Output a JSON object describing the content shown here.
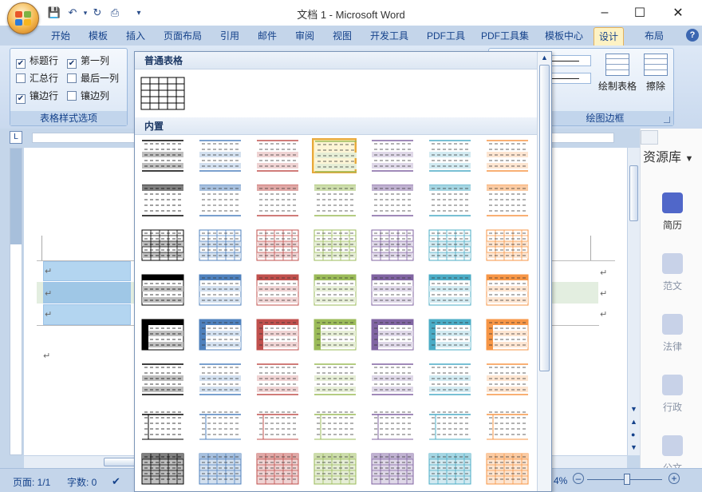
{
  "window": {
    "title": "文档 1 - Microsoft Word",
    "controls": {
      "minimize": "–",
      "maximize": "☐",
      "close": "✕"
    }
  },
  "quick_access": {
    "save_icon": "save-icon",
    "undo_icon": "undo-icon",
    "redo_icon": "redo-icon",
    "print_icon": "print-icon",
    "customize_icon": "dropdown-icon"
  },
  "tabs": [
    "开始",
    "模板",
    "插入",
    "页面布局",
    "引用",
    "邮件",
    "审阅",
    "视图",
    "开发工具",
    "PDF工具",
    "PDF工具集",
    "模板中心",
    "设计",
    "布局"
  ],
  "active_tab": "设计",
  "ribbon": {
    "style_options": {
      "label": "表格样式选项",
      "items": [
        {
          "label": "标题行",
          "checked": true
        },
        {
          "label": "第一列",
          "checked": true
        },
        {
          "label": "汇总行",
          "checked": false
        },
        {
          "label": "最后一列",
          "checked": false
        },
        {
          "label": "镶边行",
          "checked": true
        },
        {
          "label": "镶边列",
          "checked": false
        }
      ]
    },
    "borders": {
      "label": "绘图边框",
      "draw_table": "绘制表格",
      "erase": "擦除"
    }
  },
  "gallery": {
    "plain_header": "普通表格",
    "builtin_header": "内置",
    "colors": [
      "#000000",
      "#4f81bd",
      "#c0504d",
      "#9bbb59",
      "#8064a2",
      "#4bacc6",
      "#f79646"
    ],
    "selected": {
      "row": 0,
      "col": 3
    },
    "rows": [
      "light-shading",
      "light-list",
      "light-grid",
      "medium-shading-1",
      "medium-shading-2",
      "medium-list-1",
      "medium-list-2",
      "medium-grid-1"
    ]
  },
  "side_panel": {
    "title": "资源库",
    "items": [
      "简历",
      "范文",
      "法律",
      "行政",
      "公文"
    ]
  },
  "status": {
    "page": "页面: 1/1",
    "words": "字数: 0",
    "zoom": "4%"
  },
  "doc": {
    "para_mark": "↵"
  }
}
